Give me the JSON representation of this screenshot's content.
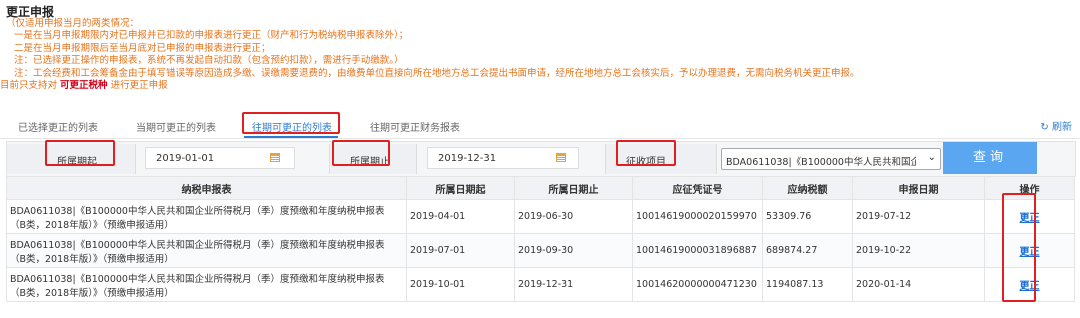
{
  "page": {
    "title": "更正申报",
    "notes": [
      "（仅适用申报当月的两类情况：",
      "一是在当月申报期限内对已申报并已扣款的申报表进行更正（财产和行为税纳税申报表除外）；",
      "二是在当月申报期限后至当月底对已申报的申报表进行更正；",
      "注：已选择更正操作的申报表，系统不再发起自动扣款（包含预约扣款），需进行手动缴款。）",
      "注：工会经费和工会筹备金由于填写错误等原因造成多缴、误缴需要退费的，由缴费单位直接向所在地地方总工会提出书面申请，经所在地地方总工会核实后，予以办理退费，无需向税务机关更正申报。"
    ],
    "last_line_prefix": "目前只支持对",
    "last_line_link": "可更正税种",
    "last_line_suffix": "进行更正申报"
  },
  "tabs": [
    {
      "label": "已选择更正的列表"
    },
    {
      "label": "当期可更正的列表"
    },
    {
      "label": "往期可更正的列表"
    },
    {
      "label": "往期可更正财务报表"
    }
  ],
  "refresh_label": "刷新",
  "filter": {
    "start_label": "所属期起",
    "start_value": "2019-01-01",
    "end_label": "所属期止",
    "end_value": "2019-12-31",
    "item_label": "征收项目",
    "item_value": "BDA0611038|《B100000中华人民共和国企",
    "query_label": "查询"
  },
  "table": {
    "headers": [
      "纳税申报表",
      "所属日期起",
      "所属日期止",
      "应征凭证号",
      "应纳税额",
      "申报日期",
      "操作"
    ],
    "rows": [
      {
        "form_line1": "BDA0611038|《B100000中华人民共和国企业所得税月（季）度预缴和年度纳税申报表",
        "form_line2": "（B类，2018年版）》（预缴申报适用）",
        "start": "2019-04-01",
        "end": "2019-06-30",
        "voucher": "10014619000020159970",
        "tax": "53309.76",
        "date": "2019-07-12",
        "op": "更正"
      },
      {
        "form_line1": "BDA0611038|《B100000中华人民共和国企业所得税月（季）度预缴和年度纳税申报表",
        "form_line2": "（B类，2018年版）》（预缴申报适用）",
        "start": "2019-07-01",
        "end": "2019-09-30",
        "voucher": "10014619000031896887",
        "tax": "689874.27",
        "date": "2019-10-22",
        "op": "更正"
      },
      {
        "form_line1": "BDA0611038|《B100000中华人民共和国企业所得税月（季）度预缴和年度纳税申报表",
        "form_line2": "（B类，2018年版）》（预缴申报适用）",
        "start": "2019-10-01",
        "end": "2019-12-31",
        "voucher": "10014620000000471230",
        "tax": "1194087.13",
        "date": "2020-01-14",
        "op": "更正"
      }
    ]
  },
  "colors": {
    "accent": "#2b7cd3",
    "notes": "#e8731b",
    "highlight": "#e02020",
    "query_button": "#5aa6f0"
  }
}
